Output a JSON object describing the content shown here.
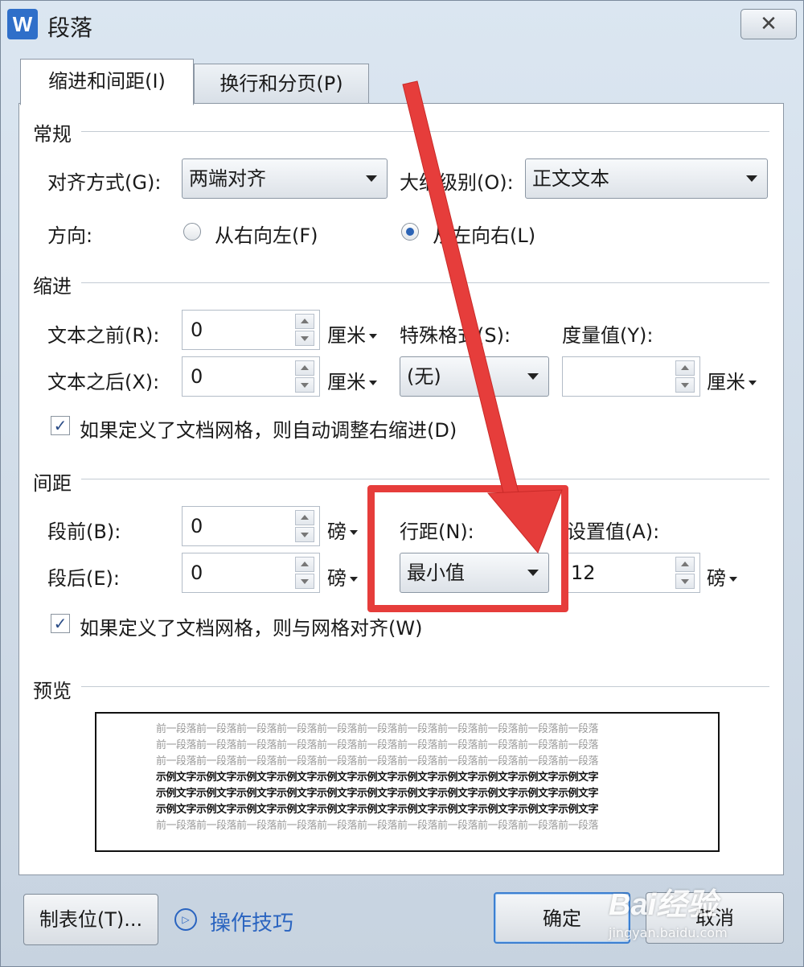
{
  "window": {
    "title": "段落",
    "app_icon_letter": "W"
  },
  "tabs": [
    {
      "label": "缩进和间距(I)",
      "active": true
    },
    {
      "label": "换行和分页(P)",
      "active": false
    }
  ],
  "general": {
    "section_title": "常规",
    "alignment_label": "对齐方式(G):",
    "alignment_value": "两端对齐",
    "outline_label": "大纲级别(O):",
    "outline_value": "正文文本",
    "direction_label": "方向:",
    "direction_rtl": "从右向左(F)",
    "direction_ltr": "从左向右(L)"
  },
  "indent": {
    "section_title": "缩进",
    "before_label": "文本之前(R):",
    "before_value": "0",
    "after_label": "文本之后(X):",
    "after_value": "0",
    "unit": "厘米",
    "special_label": "特殊格式(S):",
    "special_value": "(无)",
    "measure_label": "度量值(Y):",
    "measure_value": "",
    "grid_checkbox_label": "如果定义了文档网格，则自动调整右缩进(D)",
    "grid_checked": true
  },
  "spacing": {
    "section_title": "间距",
    "before_label": "段前(B):",
    "before_value": "0",
    "after_label": "段后(E):",
    "after_value": "0",
    "unit": "磅",
    "line_spacing_label": "行距(N):",
    "line_spacing_value": "最小值",
    "setting_label": "设置值(A):",
    "setting_value": "12",
    "grid_checkbox_label": "如果定义了文档网格，则与网格对齐(W)",
    "grid_checked": true
  },
  "preview": {
    "section_title": "预览",
    "prev_text": "前一段落前一段落前一段落前一段落前一段落前一段落前一段落前一段落前一段落前一段落前一段落",
    "cur_text": "示例文字示例文字示例文字示例文字示例文字示例文字示例文字示例文字示例文字示例文字示例文字"
  },
  "buttons": {
    "tabs_label": "制表位(T)...",
    "tips_label": "操作技巧",
    "ok_label": "确定",
    "cancel_label": "取消"
  },
  "watermark": {
    "logo": "Bai经验",
    "url": "jingyan.baidu.com"
  },
  "colors": {
    "annotation_red": "#e63d3b",
    "link_blue": "#2a64c0",
    "radio_blue": "#2b63b5"
  }
}
